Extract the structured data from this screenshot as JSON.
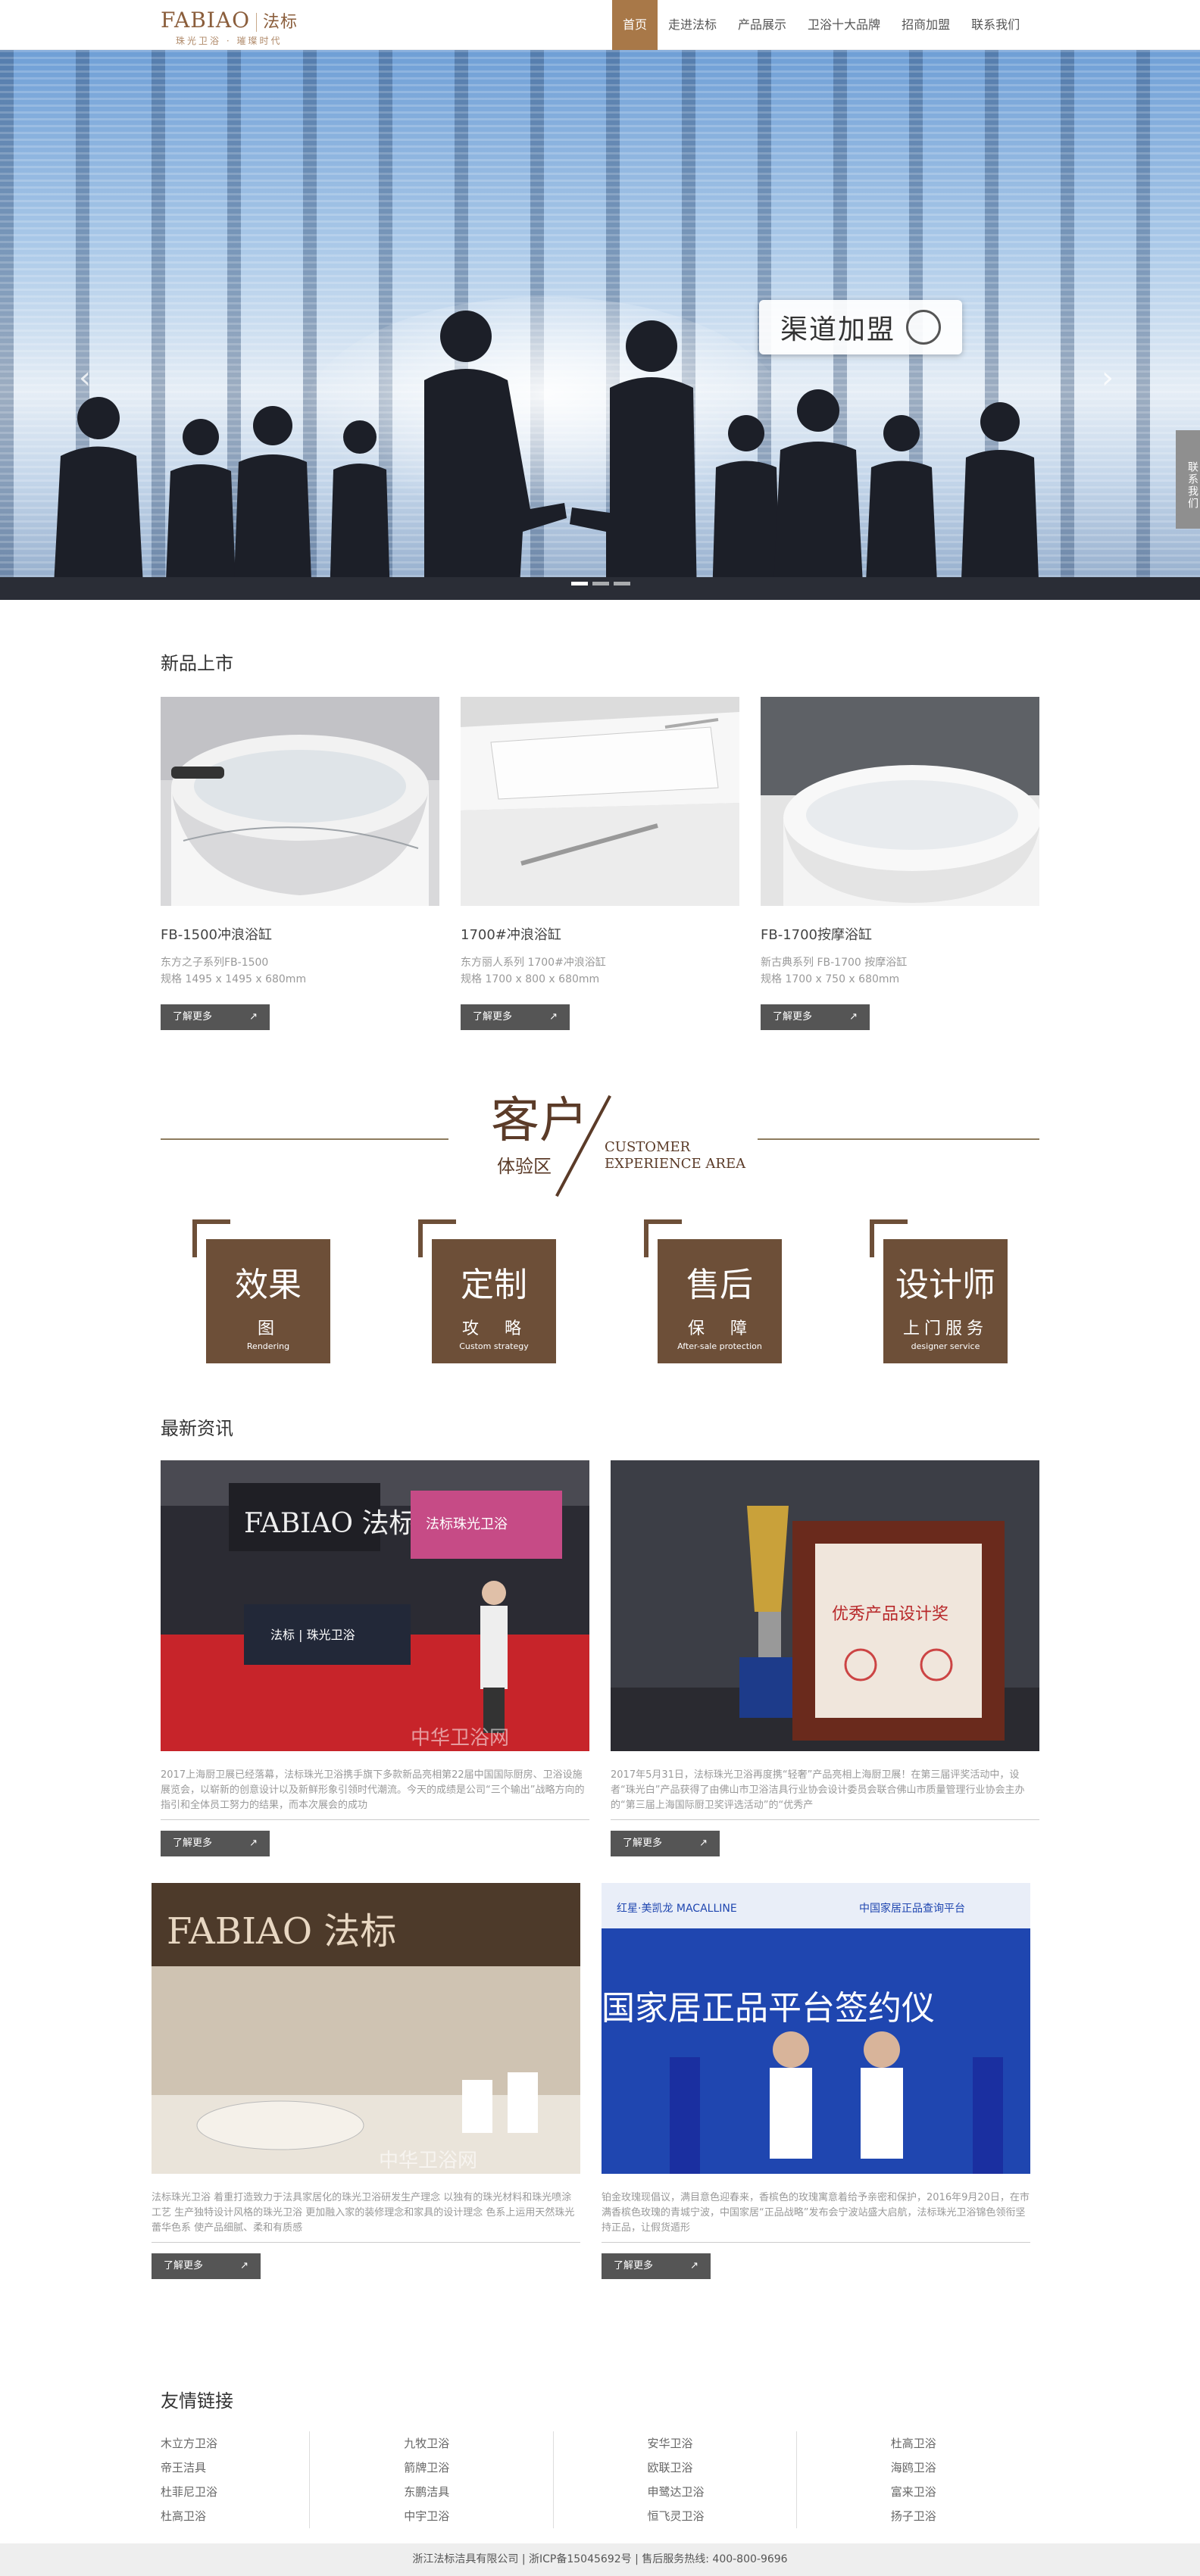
{
  "header": {
    "logo_text": "FABIAO",
    "logo_cn": "法标",
    "logo_tagline": "珠光卫浴 · 璀璨时代",
    "nav": [
      "首页",
      "走进法标",
      "产品展示",
      "卫浴十大品牌",
      "招商加盟",
      "联系我们"
    ]
  },
  "banner": {
    "badge_text": "渠道加盟",
    "prev_icon": "chevron-left-icon",
    "next_icon": "chevron-right-icon"
  },
  "side_contact": "联系我们",
  "new_products": {
    "title": "新品上市",
    "items": [
      {
        "name": "FB-1500冲浪浴缸",
        "line1": "东方之子系列FB-1500",
        "line2": "规格 1495 x 1495 x 680mm",
        "button": "了解更多"
      },
      {
        "name": "1700#冲浪浴缸",
        "line1": "东方丽人系列 1700#冲浪浴缸",
        "line2": "规格 1700 x 800 x 680mm",
        "button": "了解更多"
      },
      {
        "name": "FB-1700按摩浴缸",
        "line1": "新古典系列 FB-1700 按摩浴缸",
        "line2": "规格 1700 x 750 x 680mm",
        "button": "了解更多"
      }
    ]
  },
  "experience": {
    "cn_big": "客户",
    "cn_small": "体验区",
    "en_line1": "CUSTOMER",
    "en_line2": "EXPERIENCE AREA",
    "cards": [
      {
        "big": "效果",
        "mid": "图",
        "en": "Rendering"
      },
      {
        "big": "定制",
        "mid": "攻　略",
        "en": "Custom strategy"
      },
      {
        "big": "售后",
        "mid": "保　障",
        "en": "After-sale protection"
      },
      {
        "big": "设计师",
        "mid": "上门服务",
        "en": "designer service"
      }
    ]
  },
  "news": {
    "title": "最新资讯",
    "items": [
      {
        "text": "2017上海厨卫展已经落幕，法标珠光卫浴携手旗下多款新品亮相第22届中国国际厨房、卫浴设施展览会，以崭新的创意设计以及新鲜形象引领时代潮流。今天的成绩是公司“三个输出”战略方向的指引和全体员工努力的结果，而本次展会的成功",
        "button": "了解更多"
      },
      {
        "text": "2017年5月31日，法标珠光卫浴再度携“轻奢”产品亮相上海厨卫展！在第三届评奖活动中，设者“珠光白”产品获得了由佛山市卫浴洁具行业协会设计委员会联合佛山市质量管理行业协会主办的“第三届上海国际厨卫奖评选活动”的“优秀产",
        "button": "了解更多"
      },
      {
        "text": "法标珠光卫浴 着重打造致力于法具家居化的珠光卫浴研发生产理念 以独有的珠光材料和珠光喷涂工艺 生产独特设计风格的珠光卫浴 更加融入家的装修理念和家具的设计理念 色系上运用天然珠光蕾华色系 使产品细腻、柔和有质感",
        "button": "了解更多"
      },
      {
        "text": "铂金玫瑰现倡议，满目意色迎春来，香槟色的玫瑰寓意着给予亲密和保护，2016年9月20日，在市满香槟色玫瑰的青城宁波，中国家居“正品战略”发布会宁波站盛大启航，法标珠光卫浴锦色领衔坚持正品，让假货遁形",
        "button": "了解更多"
      }
    ],
    "photo_watermark": "中华卫浴网",
    "photo1_sign1": "FABIAO 法标",
    "photo1_sign2": "法标珠光卫浴",
    "photo1_desk": "法标 | 珠光卫浴",
    "photo2_plaque": "优秀产品设计奖",
    "photo3_sign": "FABIAO 法标",
    "photo4_banner": "国家居正品平台签约仪",
    "photo4_top": "中国家居正品查询平台",
    "photo4_brand": "红星·美凯龙 MACALLINE"
  },
  "links": {
    "title": "友情链接",
    "columns": [
      [
        "木立方卫浴",
        "帝王洁具",
        "杜菲尼卫浴",
        "杜高卫浴"
      ],
      [
        "九牧卫浴",
        "箭牌卫浴",
        "东鹏洁具",
        "中宇卫浴"
      ],
      [
        "安华卫浴",
        "欧联卫浴",
        "申鹭达卫浴",
        "恒飞灵卫浴"
      ],
      [
        "杜高卫浴",
        "海鸥卫浴",
        "富来卫浴",
        "扬子卫浴"
      ]
    ]
  },
  "footer": "浙江法标洁具有限公司 | 浙ICP备15045692号 | 售后服务热线: 400-800-9696"
}
